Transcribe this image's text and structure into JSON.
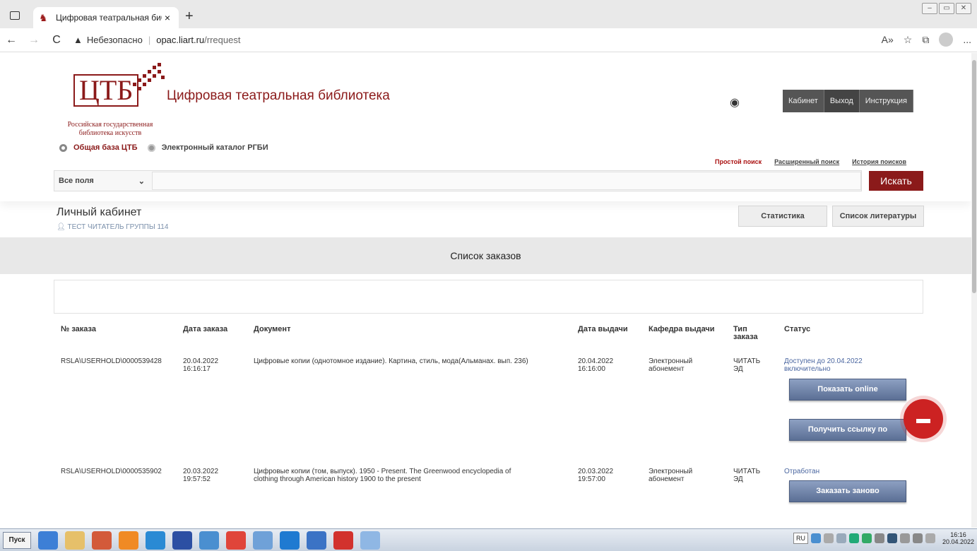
{
  "browser": {
    "tab_title": "Цифровая театральная библио",
    "tab_close": "×",
    "new_tab": "+",
    "back": "←",
    "forward": "→",
    "reload": "C",
    "warning_icon": "▲",
    "insecure_label": "Небезопасно",
    "url_host": "opac.liart.ru",
    "url_path": "/rrequest",
    "read_aloud": "A»",
    "more": "..."
  },
  "header": {
    "logo_letters": "ЦТБ",
    "logo_subtitle_1": "Российская государственная",
    "logo_subtitle_2": "библиотека искусств",
    "site_title": "Цифровая театральная библиотека",
    "btn_cabinet": "Кабинет",
    "btn_exit": "Выход",
    "btn_instruction": "Инструкция"
  },
  "catalogs": {
    "db1": "Общая база ЦТБ",
    "db2": "Электронный каталог РГБИ"
  },
  "search": {
    "simple": "Простой поиск",
    "advanced": "Расширенный поиск",
    "history": "История поисков",
    "field_select": "Все поля",
    "go": "Искать"
  },
  "cabinet": {
    "title": "Личный кабинет",
    "user": "ТЕСТ ЧИТАТЕЛЬ ГРУППЫ 114",
    "stats": "Статистика",
    "lit_list": "Список литературы"
  },
  "orders": {
    "heading": "Список заказов",
    "columns": {
      "num": "№ заказа",
      "date": "Дата заказа",
      "doc": "Документ",
      "issue_date": "Дата выдачи",
      "dept": "Кафедра выдачи",
      "type_1": "Тип",
      "type_2": "заказа",
      "status": "Статус"
    },
    "rows": [
      {
        "num": "RSLA\\USERHOLD\\0000539428",
        "date_1": "20.04.2022",
        "date_2": "16:16:17",
        "doc_1": "Цифровые копии (однотомное издание). Картина, стиль, мода(Альманах. вып. 236)",
        "doc_2": "",
        "issue_1": "20.04.2022",
        "issue_2": "16:16:00",
        "dept_1": "Электронный",
        "dept_2": "абонемент",
        "type_1": "ЧИТАТЬ",
        "type_2": "ЭД",
        "status_1": "Доступен до 20.04.2022",
        "status_2": "включительно",
        "btn_1": "Показать online",
        "btn_2": "Получить ссылку по"
      },
      {
        "num": "RSLA\\USERHOLD\\0000535902",
        "date_1": "20.03.2022",
        "date_2": "19:57:52",
        "doc_1": "Цифровые копии (том, выпуск). 1950 - Present. The Greenwood encyclopedia of",
        "doc_2": "clothing through American history 1900 to the present",
        "issue_1": "20.03.2022",
        "issue_2": "19:57:00",
        "dept_1": "Электронный",
        "dept_2": "абонемент",
        "type_1": "ЧИТАТЬ",
        "type_2": "ЭД",
        "status_1": "Отработан",
        "btn_1": "Заказать заново"
      }
    ]
  },
  "taskbar": {
    "start": "Пуск",
    "lang": "RU",
    "time": "16:16",
    "date": "20.04.2022"
  },
  "colors": {
    "brand": "#8b1a1a",
    "link": "#4a66a0",
    "chat": "#cc2222"
  }
}
